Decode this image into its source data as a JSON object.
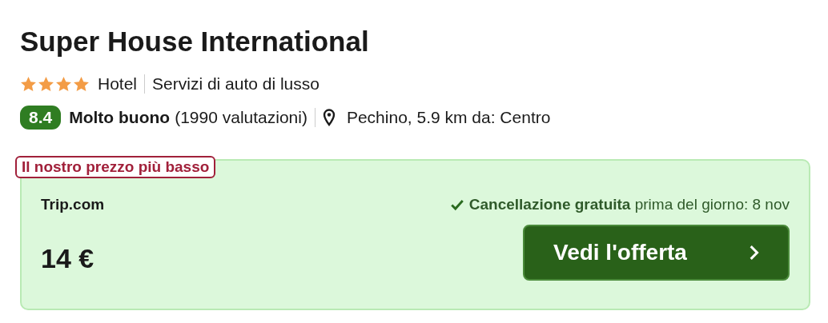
{
  "hotel": {
    "name": "Super House International",
    "stars": 4,
    "category": "Hotel",
    "feature": "Servizi di auto di lusso"
  },
  "rating": {
    "score": "8.4",
    "label": "Molto buono",
    "count": "(1990 valutazioni)",
    "location": "Pechino, 5.9 km da: Centro"
  },
  "offer": {
    "badge": "Il nostro prezzo più basso",
    "provider": "Trip.com",
    "cancellation": "**Cancellazione gratuita** prima del giorno: 8 nov",
    "price": "14 €",
    "button": "Vedi l'offerta"
  }
}
